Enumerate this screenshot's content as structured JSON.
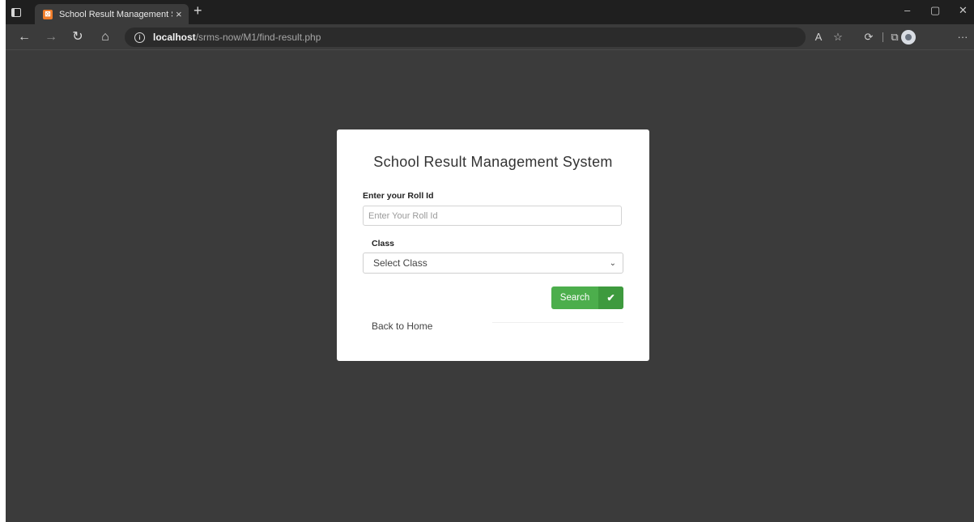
{
  "browser": {
    "tab": {
      "favicon_text": "⊠",
      "title": "School Result Management Syste",
      "close": "×"
    },
    "new_tab": "+",
    "window_controls": {
      "minimize": "–",
      "restore": "▢",
      "close": "✕"
    },
    "address": {
      "host": "localhost",
      "path": "/srms-now/M1/find-result.php"
    },
    "icons": [
      "tab-strip-icon",
      "back-icon",
      "forward-icon",
      "refresh-icon",
      "home-icon",
      "info-icon",
      "read-aloud-icon",
      "favorites-icon",
      "extensions-icon",
      "collections-icon",
      "profile-icon",
      "more-icon"
    ]
  },
  "form": {
    "title": "School Result Management System",
    "roll_label": "Enter your Roll Id",
    "roll_placeholder": "Enter Your Roll Id",
    "roll_value": "",
    "class_label": "Class",
    "class_selected": "Select Class",
    "search_label": "Search",
    "search_icon": "check-icon",
    "back_label": "Back to Home"
  },
  "colors": {
    "page_bg": "#3b3b3b",
    "titlebar_bg": "#1f1f1f",
    "card_bg": "#ffffff",
    "button_green": "#4cae4c"
  }
}
